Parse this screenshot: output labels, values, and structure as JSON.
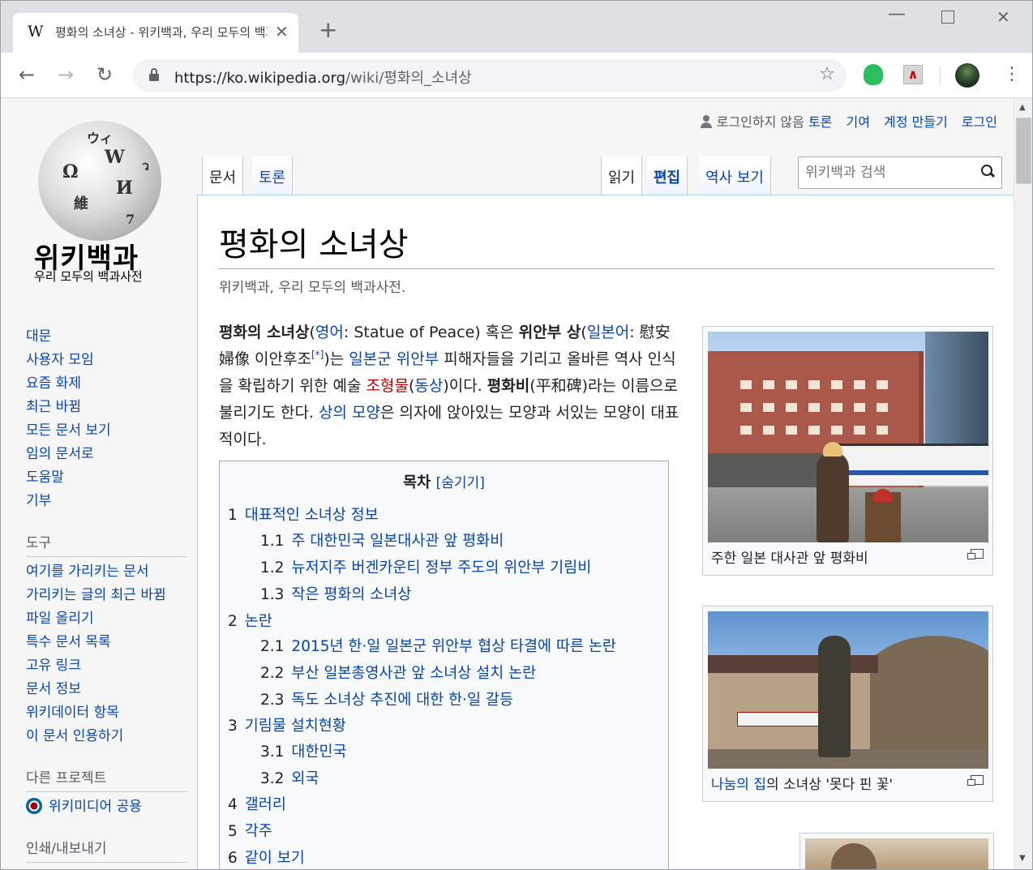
{
  "browser": {
    "tab_title": "평화의 소녀상 - 위키백과, 우리 모두의 백과사전",
    "tab_favicon": "W",
    "new_tab_label": "+",
    "url_host": "https://ko.wikipedia.org",
    "url_path": "/wiki/평화의_소녀상"
  },
  "logo": {
    "title": "위키백과",
    "subtitle": "우리 모두의 백과사전",
    "globe_glyphs": [
      "Ω",
      "W",
      "И",
      "維",
      "ウ",
      "ウィ",
      "ว",
      "7"
    ]
  },
  "personal": {
    "not_logged_in": "로그인하지 않음",
    "talk": "토론",
    "contributions": "기여",
    "create_account": "계정 만들기",
    "login": "로그인"
  },
  "tabs": {
    "article": "문서",
    "talk": "토론",
    "read": "읽기",
    "edit": "편집",
    "history": "역사 보기"
  },
  "search": {
    "placeholder": "위키백과 검색"
  },
  "sidebar": {
    "navigation": [
      "대문",
      "사용자 모임",
      "요즘 화제",
      "최근 바뀜",
      "모든 문서 보기",
      "임의 문서로",
      "도움말",
      "기부"
    ],
    "tools_heading": "도구",
    "tools": [
      "여기를 가리키는 문서",
      "가리키는 글의 최근 바뀜",
      "파일 올리기",
      "특수 문서 목록",
      "고유 링크",
      "문서 정보",
      "위키데이터 항목",
      "이 문서 인용하기"
    ],
    "projects_heading": "다른 프로젝트",
    "projects": [
      "위키미디어 공용"
    ],
    "print_heading": "인쇄/내보내기"
  },
  "article": {
    "title": "평화의 소녀상",
    "tagline": "위키백과, 우리 모두의 백과사전.",
    "lead": {
      "t1": "평화의 소녀상",
      "t2": "(",
      "l_english": "영어",
      "t3": ": Statue of Peace) 혹은 ",
      "t4": "위안부 상",
      "t5": "(",
      "l_japanese": "일본어",
      "t6": ": 慰安婦像 이안후조",
      "note": "[*]",
      "t7": ")는 ",
      "l_army": "일본군 위안부",
      "t8": " 피해자들을 기리고 올바른 역사 인식을 확립하기 위한 예술 ",
      "l_sculpture": "조형물",
      "t9": "(",
      "l_bronze": "동상",
      "t10": ")이다. ",
      "t11": "평화비",
      "t12": "(平和碑)라는 이름으로 불리기도 한다. ",
      "l_shape": "상의 모양",
      "t13": "은 의자에 앉아있는 모양과 서있는 모양이 대표적이다."
    },
    "toc": {
      "title": "목차",
      "hide_open": "[",
      "hide_label": "숨기기",
      "hide_close": "]",
      "items": [
        {
          "num": "1",
          "text": "대표적인 소녀상 정보"
        },
        {
          "num": "1.1",
          "text": "주 대한민국 일본대사관 앞 평화비"
        },
        {
          "num": "1.2",
          "text": "뉴저지주 버겐카운티 정부 주도의 위안부 기림비"
        },
        {
          "num": "1.3",
          "text": "작은 평화의 소녀상"
        },
        {
          "num": "2",
          "text": "논란"
        },
        {
          "num": "2.1",
          "text": "2015년 한·일 일본군 위안부 협상 타결에 따른 논란"
        },
        {
          "num": "2.2",
          "text": "부산 일본총영사관 앞 소녀상 설치 논란"
        },
        {
          "num": "2.3",
          "text": "독도 소녀상 추진에 대한 한·일 갈등"
        },
        {
          "num": "3",
          "text": "기림물 설치현황"
        },
        {
          "num": "3.1",
          "text": "대한민국"
        },
        {
          "num": "3.2",
          "text": "외국"
        },
        {
          "num": "4",
          "text": "갤러리"
        },
        {
          "num": "5",
          "text": "각주"
        },
        {
          "num": "6",
          "text": "같이 보기"
        }
      ]
    },
    "thumbs": [
      {
        "caption": "주한 일본 대사관 앞 평화비"
      },
      {
        "caption_link": "나눔의 집",
        "caption_rest": "의 소녀상 '못다 핀 꽃'"
      }
    ]
  }
}
